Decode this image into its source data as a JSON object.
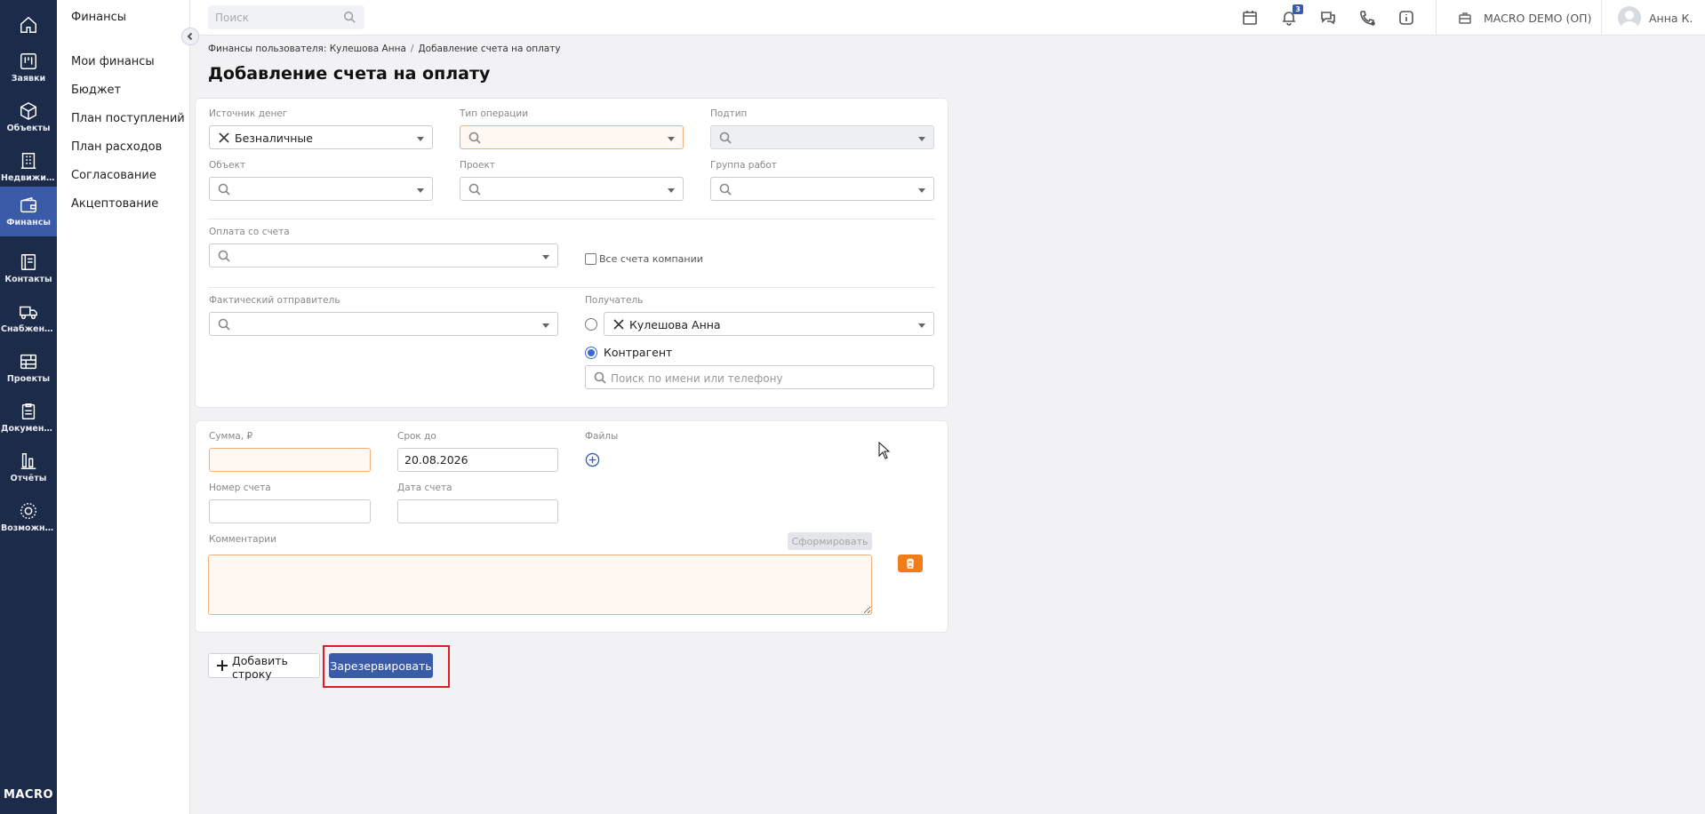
{
  "rail": {
    "items": [
      {
        "label": "",
        "icon": "home-icon"
      },
      {
        "label": "Заявки",
        "icon": "kanban-icon"
      },
      {
        "label": "Объекты",
        "icon": "cube-icon"
      },
      {
        "label": "Недвижим...",
        "icon": "building-icon"
      },
      {
        "label": "Финансы",
        "icon": "wallet-icon"
      },
      {
        "label": "Контакты",
        "icon": "contacts-icon"
      },
      {
        "label": "Снабжение",
        "icon": "truck-icon"
      },
      {
        "label": "Проекты",
        "icon": "projects-icon"
      },
      {
        "label": "Документы",
        "icon": "clipboard-icon"
      },
      {
        "label": "Отчёты",
        "icon": "bar-chart-icon"
      },
      {
        "label": "Возможно...",
        "icon": "gear-icon"
      }
    ],
    "active_index": 4,
    "logo": "MACRO",
    "active_color": "#3a5ba8",
    "bg_color": "#1c2b4a"
  },
  "subnav": {
    "title": "Финансы",
    "items": [
      "Мои финансы",
      "Бюджет",
      "План поступлений",
      "План расходов",
      "Согласование",
      "Акцептование"
    ]
  },
  "topbar": {
    "search_placeholder": "Поиск",
    "notification_count": "3",
    "company": "MACRO DEMO (ОП)",
    "user": "Анна К."
  },
  "breadcrumb": {
    "parent": "Финансы пользователя: Кулешова Анна",
    "current": "Добавление счета на оплату"
  },
  "page_title": "Добавление счета на оплату",
  "form": {
    "source_label": "Источник денег",
    "source_value": "Безналичные",
    "op_type_label": "Тип операции",
    "subtype_label": "Подтип",
    "object_label": "Объект",
    "project_label": "Проект",
    "work_group_label": "Группа работ",
    "pay_from_label": "Оплата со счета",
    "all_accounts_label": "Все счета компании",
    "actual_sender_label": "Фактический отправитель",
    "recipient_label": "Получатель",
    "recipient_value": "Кулешова Анна",
    "counterparty_label": "Контрагент",
    "counterparty_placeholder": "Поиск по имени или телефону"
  },
  "payment": {
    "amount_label": "Сумма, ₽",
    "due_label": "Срок до",
    "due_value": "20.08.2026",
    "files_label": "Файлы",
    "invoice_no_label": "Номер счета",
    "invoice_date_label": "Дата счета",
    "comment_label": "Комментарии",
    "generate_label": "Сформировать"
  },
  "actions": {
    "add_row": "Добавить строку",
    "reserve": "Зарезервировать"
  },
  "colors": {
    "primary": "#3a5ba8",
    "warning_border": "#f2b07a",
    "danger": "#f07d1a",
    "highlight": "#e01b24"
  }
}
